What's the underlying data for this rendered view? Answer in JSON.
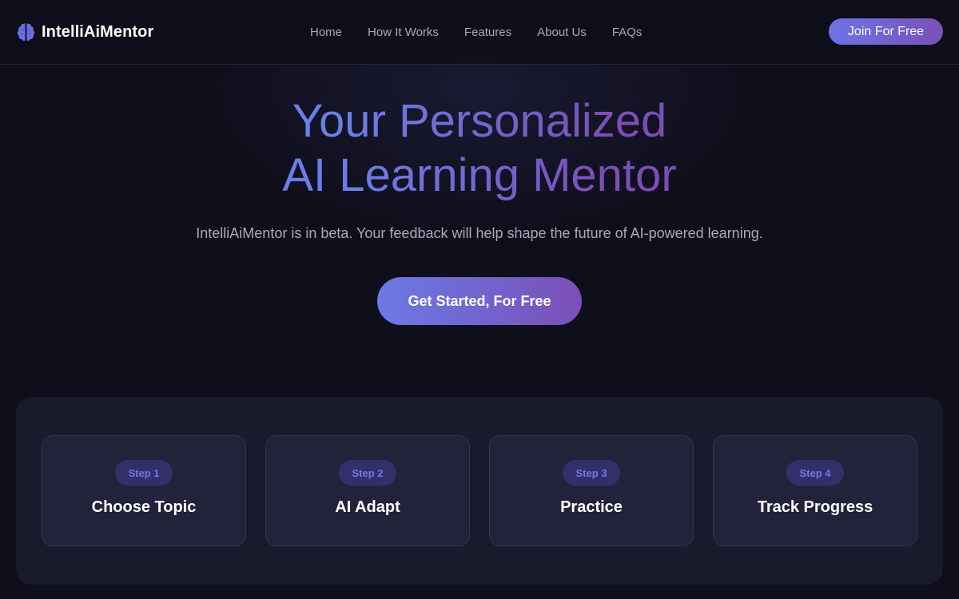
{
  "brand": {
    "name": "IntelliAiMentor",
    "icon": "brain-icon",
    "accent": "#6b74e6"
  },
  "nav": {
    "items": [
      {
        "label": "Home"
      },
      {
        "label": "How It Works"
      },
      {
        "label": "Features"
      },
      {
        "label": "About Us"
      },
      {
        "label": "FAQs"
      }
    ],
    "join_label": "Join For Free"
  },
  "hero": {
    "title_line1": "Your Personalized",
    "title_line2": "AI Learning Mentor",
    "subtitle": "IntelliAiMentor is in beta. Your feedback will help shape the future of AI-powered learning.",
    "cta_label": "Get Started, For Free"
  },
  "steps": [
    {
      "badge": "Step 1",
      "title": "Choose Topic"
    },
    {
      "badge": "Step 2",
      "title": "AI Adapt"
    },
    {
      "badge": "Step 3",
      "title": "Practice"
    },
    {
      "badge": "Step 4",
      "title": "Track Progress"
    }
  ],
  "colors": {
    "background": "#0f0f1c",
    "gradient_start": "#6b74e6",
    "gradient_end": "#7c4fb8",
    "badge_text": "#7277e6"
  }
}
